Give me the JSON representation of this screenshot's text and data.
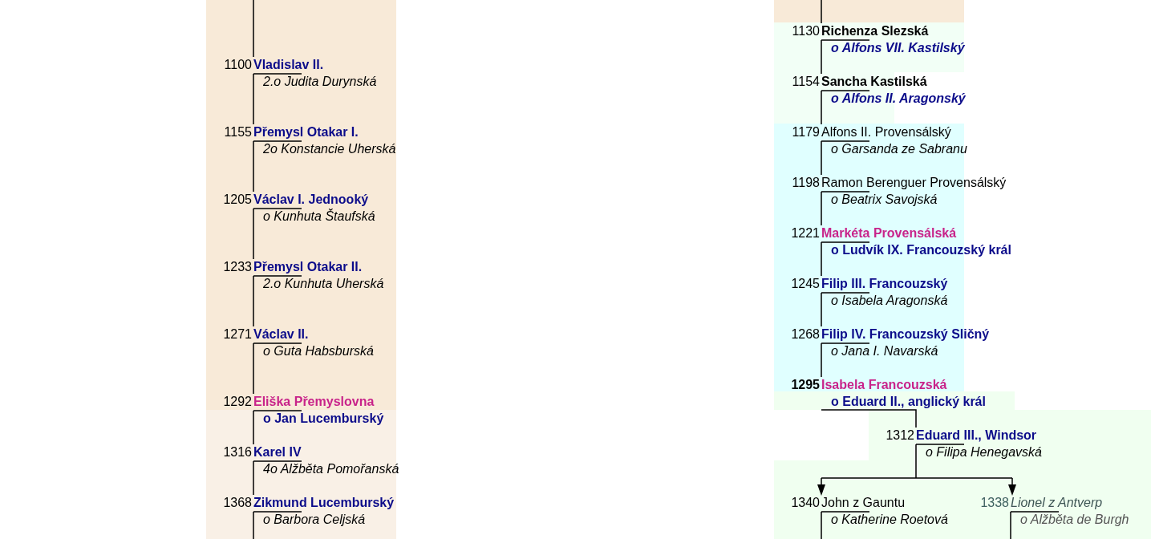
{
  "left_lineage": {
    "entries": [
      {
        "year": "1100",
        "year_bold": false,
        "name": "Vladislav II.",
        "kind": "ruler",
        "spouse": {
          "text": "2.o Judita Durynská",
          "kind": "italic"
        }
      },
      {
        "year": "1155",
        "year_bold": false,
        "name": "Přemysl Otakar I.",
        "kind": "ruler",
        "spouse": {
          "text": "2o Konstancie Uherská",
          "kind": "italic"
        }
      },
      {
        "year": "1205",
        "year_bold": false,
        "name": "Václav I. Jednooký",
        "kind": "ruler",
        "spouse": {
          "text": "o Kunhuta Štaufská",
          "kind": "italic"
        }
      },
      {
        "year": "1233",
        "year_bold": false,
        "name": "Přemysl Otakar II.",
        "kind": "ruler",
        "spouse": {
          "text": "2.o Kunhuta Uherská",
          "kind": "italic"
        }
      },
      {
        "year": "1271",
        "year_bold": false,
        "name": "Václav II.",
        "kind": "ruler",
        "spouse": {
          "text": "o Guta Habsburská",
          "kind": "italic"
        }
      },
      {
        "year": "1292",
        "year_bold": false,
        "name": "Eliška Přemyslovna",
        "kind": "heiress",
        "spouse": {
          "text": "o Jan Lucemburský",
          "kind": "ruler"
        }
      },
      {
        "year": "1316",
        "year_bold": false,
        "name": "Karel IV",
        "kind": "ruler",
        "spouse": {
          "text": "4o Alžběta Pomořanská",
          "kind": "italic"
        }
      },
      {
        "year": "1368",
        "year_bold": false,
        "name": "Zikmund Lucemburský",
        "kind": "ruler",
        "spouse": {
          "text": "o Barbora Celjská",
          "kind": "italic"
        }
      }
    ]
  },
  "right_lineage": {
    "entries": [
      {
        "year": "1130",
        "year_bold": false,
        "name": "Richenza Slezská",
        "kind": "bold",
        "spouse": {
          "text": "o Alfons VII. Kastilský",
          "kind": "rulerItalic"
        }
      },
      {
        "year": "1154",
        "year_bold": false,
        "name": "Sancha Kastilská",
        "kind": "bold",
        "spouse": {
          "text": "o Alfons II. Aragonský",
          "kind": "rulerItalic"
        }
      },
      {
        "year": "1179",
        "year_bold": false,
        "name": "Alfons II. Provensálský",
        "kind": "plain",
        "spouse": {
          "text": "o Garsanda ze Sabranu",
          "kind": "italic"
        }
      },
      {
        "year": "1198",
        "year_bold": false,
        "name": "Ramon Berenguer Provensálský",
        "kind": "plain",
        "spouse": {
          "text": "o Beatrix Savojská",
          "kind": "italic"
        }
      },
      {
        "year": "1221",
        "year_bold": false,
        "name": "Markéta Provensálská",
        "kind": "heiress",
        "spouse": {
          "text": "o Ludvík IX. Francouzský král",
          "kind": "ruler"
        }
      },
      {
        "year": "1245",
        "year_bold": false,
        "name": "Filip III. Francouzský",
        "kind": "ruler",
        "spouse": {
          "text": "o Isabela Aragonská",
          "kind": "italic"
        }
      },
      {
        "year": "1268",
        "year_bold": false,
        "name": "Filip IV. Francouzský Sličný",
        "kind": "ruler",
        "spouse": {
          "text": "o Jana I. Navarská",
          "kind": "italic"
        }
      },
      {
        "year": "1295",
        "year_bold": true,
        "name": "Isabela Francouzská",
        "kind": "heiress",
        "spouse": {
          "text": "o Eduard II., anglický král",
          "kind": "ruler"
        }
      }
    ]
  },
  "branch": {
    "parent": {
      "year": "1312",
      "year_bold": false,
      "name": "Eduard III., Windsor",
      "kind": "ruler",
      "spouse": {
        "text": "o Filipa Henegavská",
        "kind": "italic"
      }
    },
    "children": [
      {
        "year": "1340",
        "year_bold": false,
        "name": "John z Gauntu",
        "kind": "plain",
        "spouse": {
          "text": "o Katherine Roetová",
          "kind": "italic"
        }
      },
      {
        "year": "1338",
        "year_bold": false,
        "name": "Lionel z Antverp",
        "kind": "faded",
        "spouse": {
          "text": "o Alžběta de Burgh",
          "kind": "faded"
        }
      }
    ]
  }
}
